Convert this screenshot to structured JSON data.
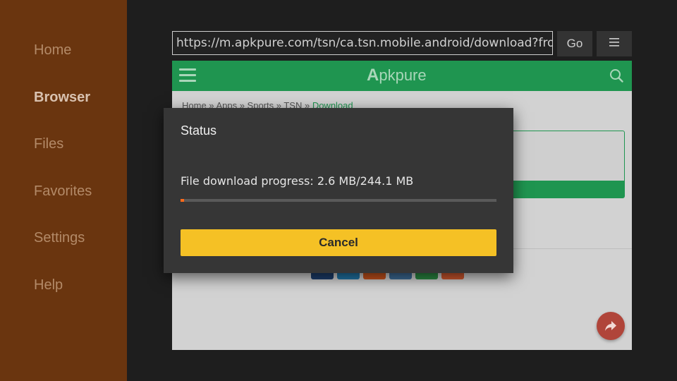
{
  "sidebar": {
    "items": [
      {
        "label": "Home",
        "active": false
      },
      {
        "label": "Browser",
        "active": true
      },
      {
        "label": "Files",
        "active": false
      },
      {
        "label": "Favorites",
        "active": false
      },
      {
        "label": "Settings",
        "active": false
      },
      {
        "label": "Help",
        "active": false
      }
    ]
  },
  "address_bar": {
    "url": "https://m.apkpure.com/tsn/ca.tsn.mobile.android/download?from=details",
    "go_label": "Go",
    "menu_icon": "menu-icon"
  },
  "webpage": {
    "header": {
      "logo_mark": "A",
      "logo_text": "pkpure",
      "menu_icon": "hamburger-icon",
      "search_icon": "search-icon"
    },
    "breadcrumb": [
      "Home",
      "Apps",
      "Sports",
      "TSN",
      "Download"
    ],
    "share_colors": [
      "#1d3f6e",
      "#2176a8",
      "#c8531c",
      "#3d6c97",
      "#2b8a43",
      "#d0582e"
    ],
    "fab_icon": "share-arrow-icon"
  },
  "dialog": {
    "title": "Status",
    "progress_text": "File download progress: 2.6 MB/244.1 MB",
    "progress_fraction": 0.0107,
    "cancel_label": "Cancel"
  },
  "colors": {
    "sidebar_bg": "#6a350f",
    "site_green": "#1f9550",
    "accent_yellow": "#f5c125",
    "progress_orange": "#ff6a1a"
  }
}
